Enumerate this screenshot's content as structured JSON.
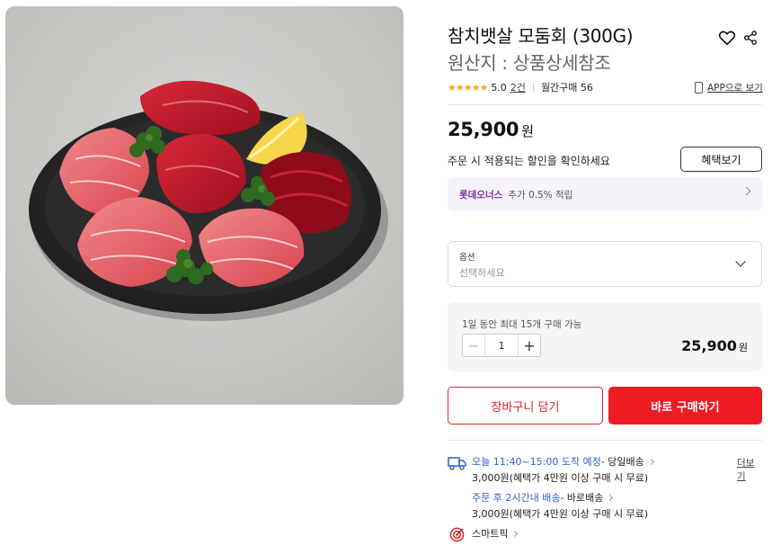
{
  "product": {
    "title": "참치뱃살 모둠회 (300G)",
    "origin": "원산지 : 상품상세참조"
  },
  "rating": {
    "stars": "★★★★★",
    "score": "5.0",
    "review_count": "2건",
    "monthly_purchase": "월간구매 56",
    "app_link": "APP으로 보기"
  },
  "price": {
    "amount": "25,900",
    "unit": "원"
  },
  "discount": {
    "text": "주문 시 적용되는 할인을 확인하세요",
    "button": "혜택보기"
  },
  "lotte": {
    "name": "롯데오너스",
    "benefit": "추가 0.5% 적립"
  },
  "option": {
    "label": "옵션",
    "placeholder": "선택하세요"
  },
  "quantity": {
    "limit": "1일 동안 최대 15개 구매 가능",
    "value": "1",
    "minus": "−",
    "plus": "+",
    "total": "25,900",
    "total_unit": "원"
  },
  "actions": {
    "cart": "장바구니 담기",
    "buy": "바로 구매하기"
  },
  "delivery": {
    "more": "더보기",
    "line1_main": "오늘 11:40~15:00 도착 예정",
    "line1_type": " - 당일배송",
    "line1_fee": "3,000원(혜택가 4만원 이상 구매 시 무료)",
    "line2_main": "주문 후 2시간내 배송",
    "line2_type": " - 바로배송",
    "line2_fee": "3,000원(혜택가 4만원 이상 구매 시 무료)",
    "smartpick": "스마트픽"
  },
  "colors": {
    "accent_red": "#ee1b23",
    "star": "#f5a623",
    "lotte_purple": "#7b2ea8",
    "delivery_blue": "#2f63c7"
  },
  "icons": [
    "heart-icon",
    "share-icon",
    "phone-icon",
    "chevron-right-icon",
    "chevron-down-icon",
    "truck-icon",
    "target-icon"
  ]
}
